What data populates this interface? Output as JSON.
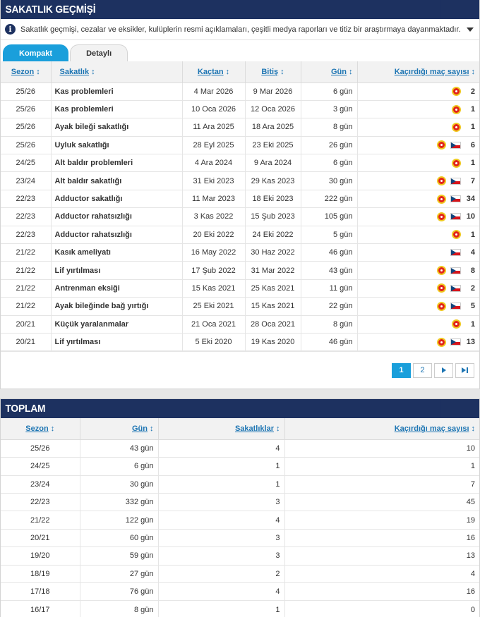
{
  "injury_box": {
    "title": "SAKATLIK GEÇMİŞİ",
    "info_text": "Sakatlık geçmişi, cezalar ve eksikler, kulüplerin resmi açıklamaları, çeşitli medya raporları ve titiz bir araştırmaya dayanmaktadır. Buna rağme…",
    "tabs": [
      {
        "label": "Kompakt",
        "active": true
      },
      {
        "label": "Detaylı",
        "active": false
      }
    ],
    "columns": [
      "Sezon",
      "Sakatlık",
      "Kaçtan",
      "Bitiş",
      "Gün",
      "Kaçırdığı maç sayısı"
    ],
    "rows": [
      {
        "season": "25/26",
        "injury": "Kas problemleri",
        "from": "4 Mar 2026",
        "until": "9 Mar 2026",
        "days": "6 gün",
        "club": true,
        "nation": false,
        "missed": "2"
      },
      {
        "season": "25/26",
        "injury": "Kas problemleri",
        "from": "10 Oca 2026",
        "until": "12 Oca 2026",
        "days": "3 gün",
        "club": true,
        "nation": false,
        "missed": "1"
      },
      {
        "season": "25/26",
        "injury": "Ayak bileği sakatlığı",
        "from": "11 Ara 2025",
        "until": "18 Ara 2025",
        "days": "8 gün",
        "club": true,
        "nation": false,
        "missed": "1"
      },
      {
        "season": "25/26",
        "injury": "Uyluk sakatlığı",
        "from": "28 Eyl 2025",
        "until": "23 Eki 2025",
        "days": "26 gün",
        "club": true,
        "nation": true,
        "missed": "6"
      },
      {
        "season": "24/25",
        "injury": "Alt baldır problemleri",
        "from": "4 Ara 2024",
        "until": "9 Ara 2024",
        "days": "6 gün",
        "club": true,
        "nation": false,
        "missed": "1"
      },
      {
        "season": "23/24",
        "injury": "Alt baldır sakatlığı",
        "from": "31 Eki 2023",
        "until": "29 Kas 2023",
        "days": "30 gün",
        "club": true,
        "nation": true,
        "missed": "7"
      },
      {
        "season": "22/23",
        "injury": "Adductor sakatlığı",
        "from": "11 Mar 2023",
        "until": "18 Eki 2023",
        "days": "222 gün",
        "club": true,
        "nation": true,
        "missed": "34"
      },
      {
        "season": "22/23",
        "injury": "Adductor rahatsızlığı",
        "from": "3 Kas 2022",
        "until": "15 Şub 2023",
        "days": "105 gün",
        "club": true,
        "nation": true,
        "missed": "10"
      },
      {
        "season": "22/23",
        "injury": "Adductor rahatsızlığı",
        "from": "20 Eki 2022",
        "until": "24 Eki 2022",
        "days": "5 gün",
        "club": true,
        "nation": false,
        "missed": "1"
      },
      {
        "season": "21/22",
        "injury": "Kasık ameliyatı",
        "from": "16 May 2022",
        "until": "30 Haz 2022",
        "days": "46 gün",
        "club": false,
        "nation": true,
        "missed": "4"
      },
      {
        "season": "21/22",
        "injury": "Lif yırtılması",
        "from": "17 Şub 2022",
        "until": "31 Mar 2022",
        "days": "43 gün",
        "club": true,
        "nation": true,
        "missed": "8"
      },
      {
        "season": "21/22",
        "injury": "Antrenman eksiği",
        "from": "15 Kas 2021",
        "until": "25 Kas 2021",
        "days": "11 gün",
        "club": true,
        "nation": true,
        "missed": "2"
      },
      {
        "season": "21/22",
        "injury": "Ayak bileğinde bağ yırtığı",
        "from": "25 Eki 2021",
        "until": "15 Kas 2021",
        "days": "22 gün",
        "club": true,
        "nation": true,
        "missed": "5"
      },
      {
        "season": "20/21",
        "injury": "Küçük yaralanmalar",
        "from": "21 Oca 2021",
        "until": "28 Oca 2021",
        "days": "8 gün",
        "club": true,
        "nation": false,
        "missed": "1"
      },
      {
        "season": "20/21",
        "injury": "Lif yırtılması",
        "from": "5 Eki 2020",
        "until": "19 Kas 2020",
        "days": "46 gün",
        "club": true,
        "nation": true,
        "missed": "13"
      }
    ],
    "pagination": {
      "pages": [
        "1",
        "2"
      ],
      "current": "1"
    }
  },
  "total_box": {
    "title": "TOPLAM",
    "columns": [
      "Sezon",
      "Gün",
      "Sakatlıklar",
      "Kaçırdığı maç sayısı"
    ],
    "rows": [
      {
        "season": "25/26",
        "days": "43 gün",
        "injuries": "4",
        "missed": "10"
      },
      {
        "season": "24/25",
        "days": "6 gün",
        "injuries": "1",
        "missed": "1"
      },
      {
        "season": "23/24",
        "days": "30 gün",
        "injuries": "1",
        "missed": "7"
      },
      {
        "season": "22/23",
        "days": "332 gün",
        "injuries": "3",
        "missed": "45"
      },
      {
        "season": "21/22",
        "days": "122 gün",
        "injuries": "4",
        "missed": "19"
      },
      {
        "season": "20/21",
        "days": "60 gün",
        "injuries": "3",
        "missed": "16"
      },
      {
        "season": "19/20",
        "days": "59 gün",
        "injuries": "3",
        "missed": "13"
      },
      {
        "season": "18/19",
        "days": "27 gün",
        "injuries": "2",
        "missed": "4"
      },
      {
        "season": "17/18",
        "days": "76 gün",
        "injuries": "4",
        "missed": "16"
      },
      {
        "season": "16/17",
        "days": "8 gün",
        "injuries": "1",
        "missed": "0"
      }
    ]
  },
  "colors": {
    "header_bg": "#1d3160",
    "accent": "#1a9fdb",
    "link": "#1d75b3"
  }
}
